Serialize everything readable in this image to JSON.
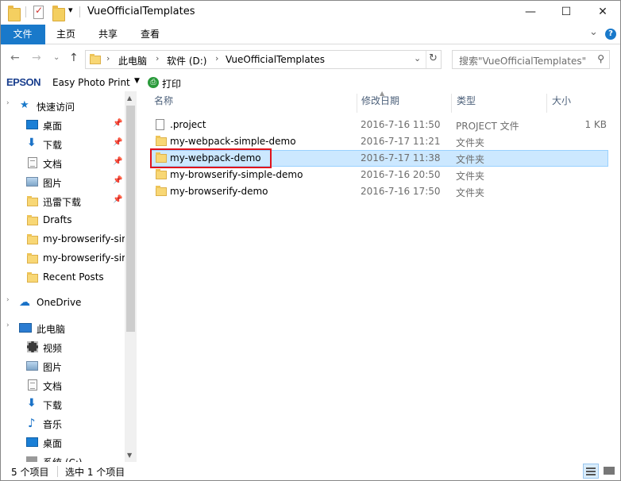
{
  "window": {
    "title": "VueOfficialTemplates",
    "minimize": "—",
    "maximize": "☐",
    "close": "✕"
  },
  "ribbon": {
    "tabs": [
      {
        "label": "文件"
      },
      {
        "label": "主页"
      },
      {
        "label": "共享"
      },
      {
        "label": "查看"
      }
    ],
    "collapse": "⌄",
    "help": "?"
  },
  "address": {
    "back": "←",
    "forward": "→",
    "recent": "⌄",
    "up": "↑",
    "crumbs": [
      "此电脑",
      "软件 (D:)",
      "VueOfficialTemplates"
    ],
    "dropdown": "⌄",
    "refresh": "↻",
    "search_placeholder": "搜索\"VueOfficialTemplates\""
  },
  "epson": {
    "brand": "EPSON",
    "app": "Easy Photo Print",
    "dropdown": "▼",
    "print_label": "打印"
  },
  "nav": {
    "quick_access": "快速访问",
    "quick_items": [
      {
        "label": "桌面",
        "pinned": true
      },
      {
        "label": "下载",
        "pinned": true
      },
      {
        "label": "文档",
        "pinned": true
      },
      {
        "label": "图片",
        "pinned": true
      },
      {
        "label": "迅雷下载",
        "pinned": true
      },
      {
        "label": "Drafts",
        "pinned": false
      },
      {
        "label": "my-browserify-sir",
        "pinned": false
      },
      {
        "label": "my-browserify-sir",
        "pinned": false
      },
      {
        "label": "Recent Posts",
        "pinned": false
      }
    ],
    "onedrive": "OneDrive",
    "this_pc": "此电脑",
    "pc_items": [
      {
        "label": "视频"
      },
      {
        "label": "图片"
      },
      {
        "label": "文档"
      },
      {
        "label": "下载"
      },
      {
        "label": "音乐"
      },
      {
        "label": "桌面"
      },
      {
        "label": "系统 (C:)"
      }
    ],
    "pin_glyph": "📌"
  },
  "columns": {
    "name": "名称",
    "date": "修改日期",
    "type": "类型",
    "size": "大小"
  },
  "files": [
    {
      "name": ".project",
      "date": "2016-7-16 11:50",
      "type": "PROJECT 文件",
      "size": "1 KB",
      "kind": "file"
    },
    {
      "name": "my-webpack-simple-demo",
      "date": "2016-7-17 11:21",
      "type": "文件夹",
      "size": "",
      "kind": "folder"
    },
    {
      "name": "my-webpack-demo",
      "date": "2016-7-17 11:38",
      "type": "文件夹",
      "size": "",
      "kind": "folder",
      "selected": true
    },
    {
      "name": "my-browserify-simple-demo",
      "date": "2016-7-16 20:50",
      "type": "文件夹",
      "size": "",
      "kind": "folder"
    },
    {
      "name": "my-browserify-demo",
      "date": "2016-7-16 17:50",
      "type": "文件夹",
      "size": "",
      "kind": "folder"
    }
  ],
  "status": {
    "item_count": "5 个项目",
    "selection": "选中 1 个项目"
  }
}
